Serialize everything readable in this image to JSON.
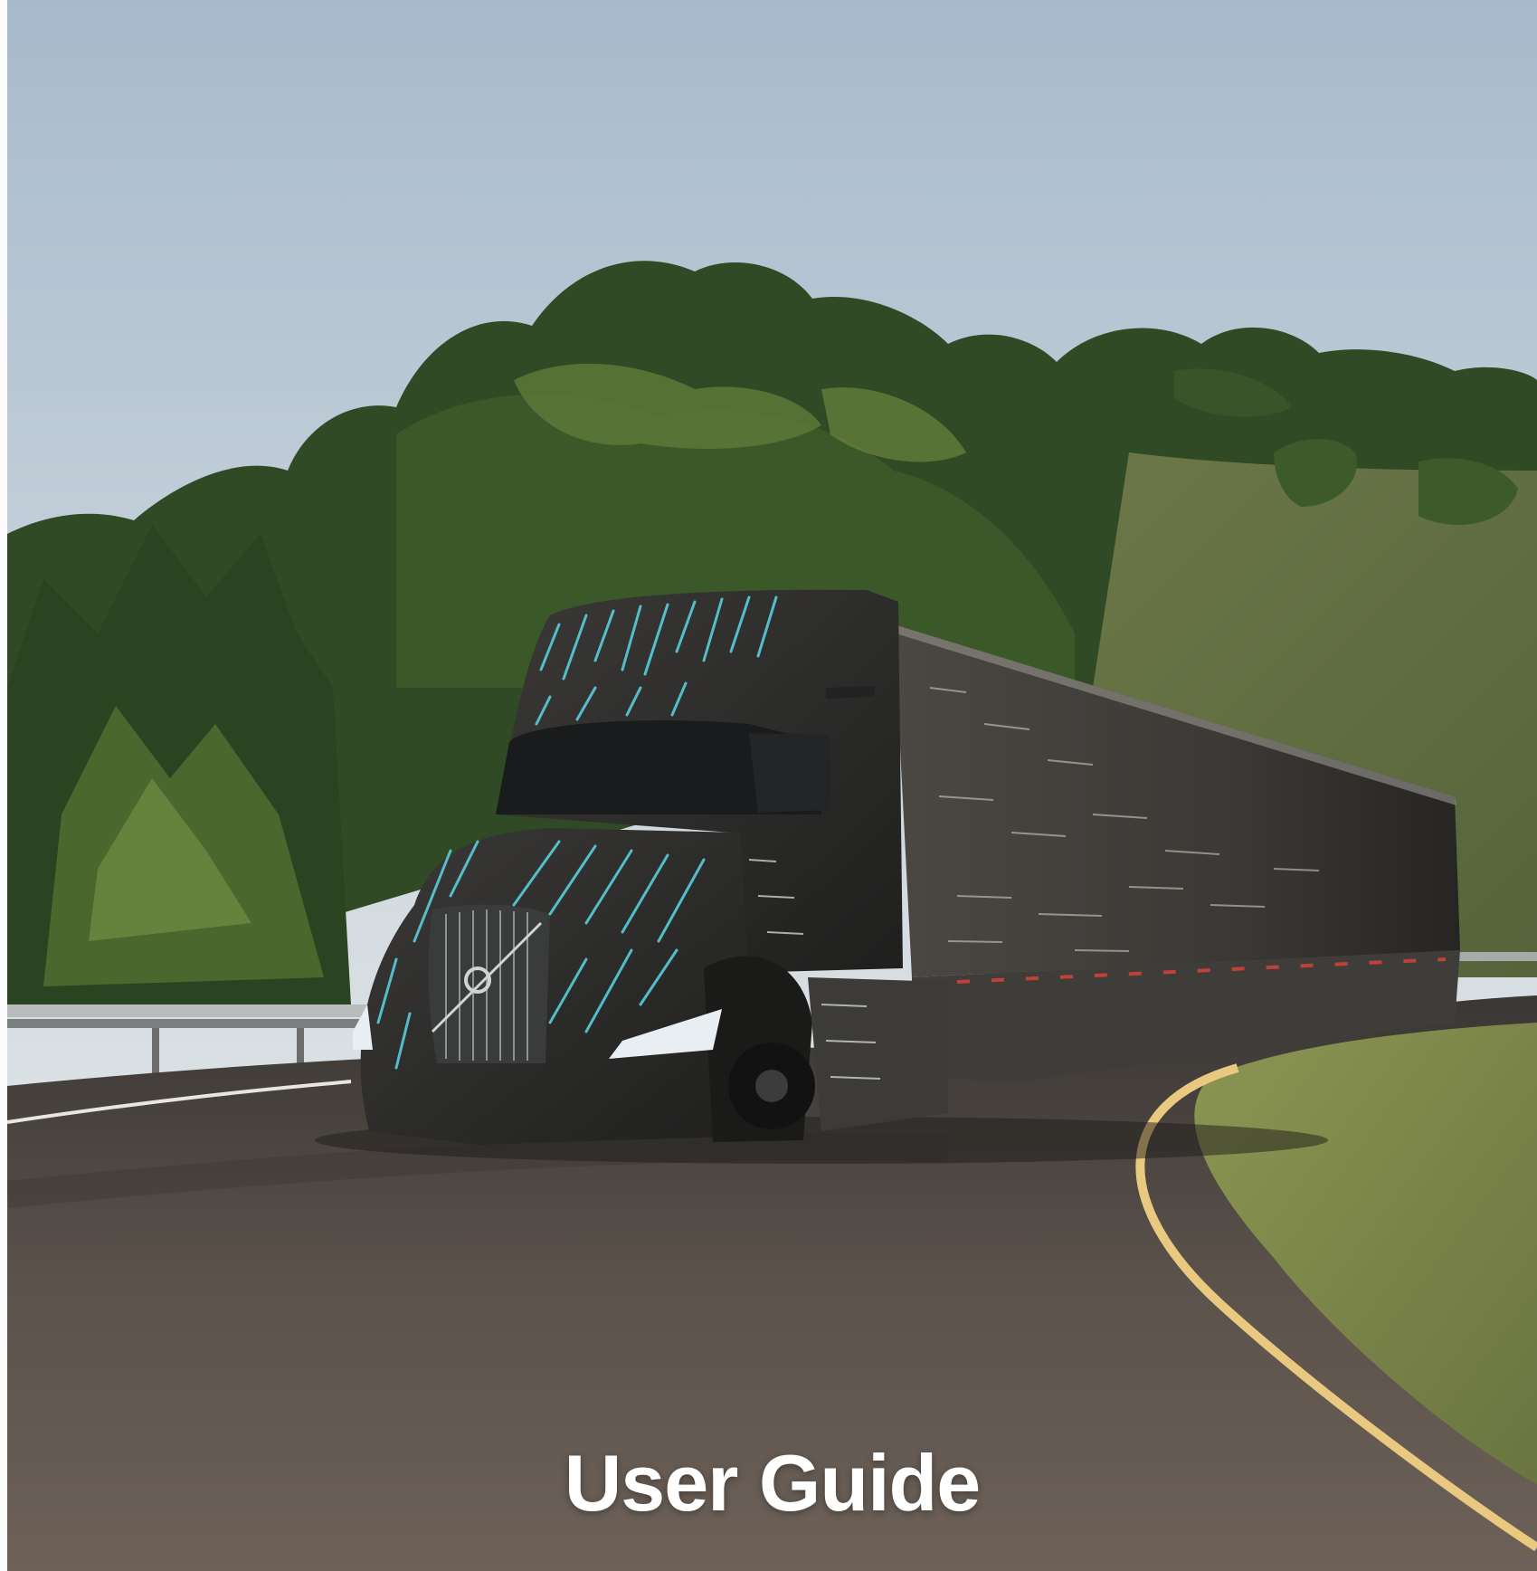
{
  "cover": {
    "title": "User Guide"
  },
  "colors": {
    "sky_top": "#a9bccd",
    "sky_bottom": "#e2e7e8",
    "forest": "#2d4622",
    "road": "#4a4540",
    "road_line": "#e9c97f",
    "grass": "#7d8a4a",
    "truck_body": "#2d2c2a",
    "streak": "#59d8e6"
  },
  "icons": {
    "emblem": "volvo-emblem-icon"
  }
}
